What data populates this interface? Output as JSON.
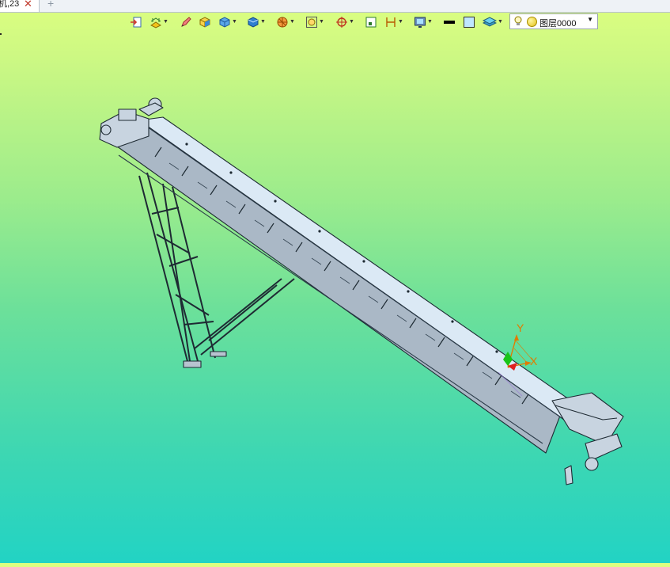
{
  "tab": {
    "label": "机,23",
    "close_glyph": "✕",
    "add_glyph": "+"
  },
  "toolbar": {
    "items": [
      "view-import-icon",
      "hidden-line-icon",
      "edit-pencil-icon",
      "shaded-solid-icon",
      "iso-view-icon",
      "view-cube-icon",
      "render-mode-icon",
      "zoom-fit-icon",
      "target-snap-icon",
      "section-plane-icon",
      "dimension-icon",
      "monitor-display-icon",
      "line-color-icon",
      "fill-color-icon",
      "layer-stack-icon"
    ],
    "layer_combo": {
      "name": "图层0000"
    }
  },
  "triad": {
    "x_label": "X",
    "y_label": "Y"
  },
  "colors": {
    "accent": "#e07b00",
    "triad_x": "#e07b00",
    "triad_y": "#e07b00",
    "triad_green": "#19c419",
    "triad_red": "#e02020",
    "model_fill": "#c8d4e0",
    "model_edge": "#1e2a33"
  }
}
